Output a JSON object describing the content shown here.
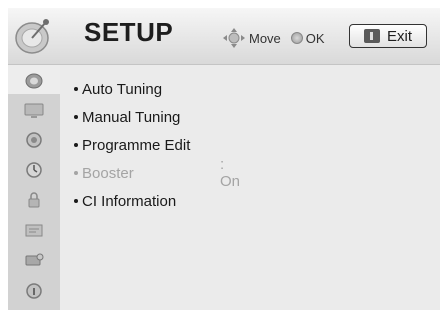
{
  "header": {
    "title": "SETUP",
    "move_label": "Move",
    "ok_label": "OK",
    "exit_label": "Exit",
    "setup_icon": "satellite-dish-icon"
  },
  "sidebar": {
    "items": [
      {
        "icon": "setup-dish-icon",
        "active": true
      },
      {
        "icon": "picture-icon",
        "active": false
      },
      {
        "icon": "audio-icon",
        "active": false
      },
      {
        "icon": "time-icon",
        "active": false
      },
      {
        "icon": "lock-icon",
        "active": false
      },
      {
        "icon": "option-icon",
        "active": false
      },
      {
        "icon": "network-icon",
        "active": false
      },
      {
        "icon": "support-icon",
        "active": false
      }
    ]
  },
  "menu": {
    "items": [
      {
        "label": "Auto Tuning",
        "value": "",
        "enabled": true
      },
      {
        "label": "Manual Tuning",
        "value": "",
        "enabled": true
      },
      {
        "label": "Programme Edit",
        "value": "",
        "enabled": true
      },
      {
        "label": "Booster",
        "value": ": On",
        "enabled": false
      },
      {
        "label": "CI Information",
        "value": "",
        "enabled": true
      }
    ]
  },
  "colors": {
    "header_bg": "#e4e4e4",
    "sidebar_bg": "#d2d2d2",
    "content_bg": "#ebebeb",
    "disabled_text": "#a4a4a4"
  }
}
